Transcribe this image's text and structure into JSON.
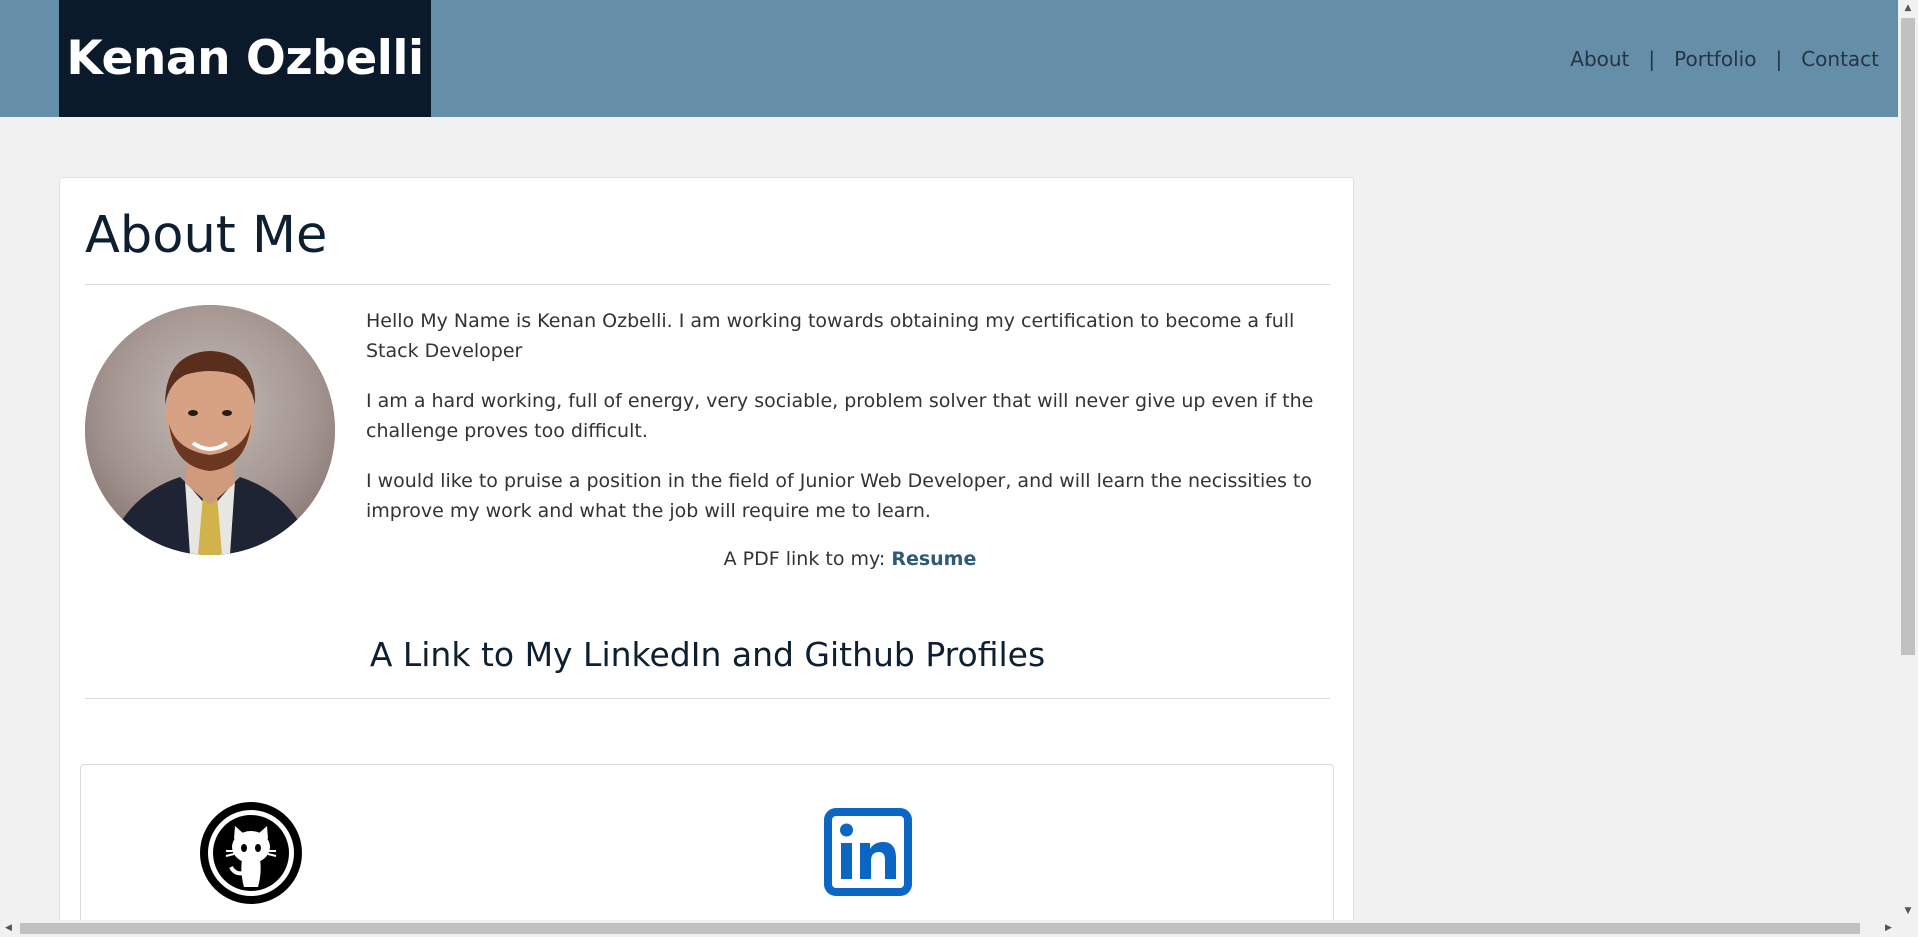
{
  "header": {
    "brand": "Kenan Ozbelli",
    "nav": {
      "about": "About",
      "portfolio": "Portfolio",
      "contact": "Contact",
      "separator": "|"
    },
    "colors": {
      "bar": "#658ea9",
      "brand_bg": "#0a1a2a"
    }
  },
  "about": {
    "title": "About Me",
    "bio": [
      "Hello My Name is Kenan Ozbelli. I am working towards obtaining my certification to become a full Stack Developer",
      "I am a hard working, full of energy, very sociable, problem solver that will never give up even if the challenge proves too difficult.",
      "I would like to pruise a position in the field of Junior Web Developer, and will learn the necissities to improve my work and what the job will require me to learn."
    ],
    "resume_prefix": "A PDF link to my:",
    "resume_link": "Resume",
    "resume_color": "#2c5a78"
  },
  "profiles": {
    "title": "A Link to My LinkedIn and Github Profiles",
    "github_icon": "github-icon",
    "linkedin_icon": "linkedin-icon",
    "linkedin_color": "#0a66c2"
  },
  "scrollbars": {
    "up": "▲",
    "down": "▼",
    "left": "◀",
    "right": "▶"
  }
}
